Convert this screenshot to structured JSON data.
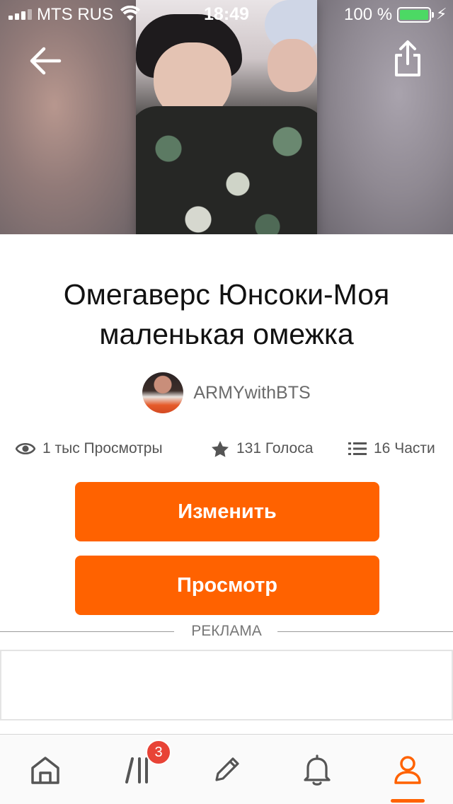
{
  "status_bar": {
    "carrier": "MTS RUS",
    "time": "18:49",
    "battery": "100 %"
  },
  "story": {
    "title": "Омегаверс Юнсоки-Моя маленькая омежка",
    "author": "ARMYwithBTS",
    "stats": {
      "views": "1 тыс Просмотры",
      "votes": "131 Голоса",
      "parts": "16 Части"
    }
  },
  "actions": {
    "edit_label": "Изменить",
    "view_label": "Просмотр"
  },
  "ad": {
    "label": "РЕКЛАМА"
  },
  "tabbar": {
    "items": [
      {
        "icon": "home-icon"
      },
      {
        "icon": "library-icon",
        "badge": "3"
      },
      {
        "icon": "pencil-icon"
      },
      {
        "icon": "bell-icon"
      },
      {
        "icon": "profile-icon",
        "active": true
      }
    ]
  },
  "colors": {
    "accent": "#ff6200",
    "badge": "#e84336"
  }
}
